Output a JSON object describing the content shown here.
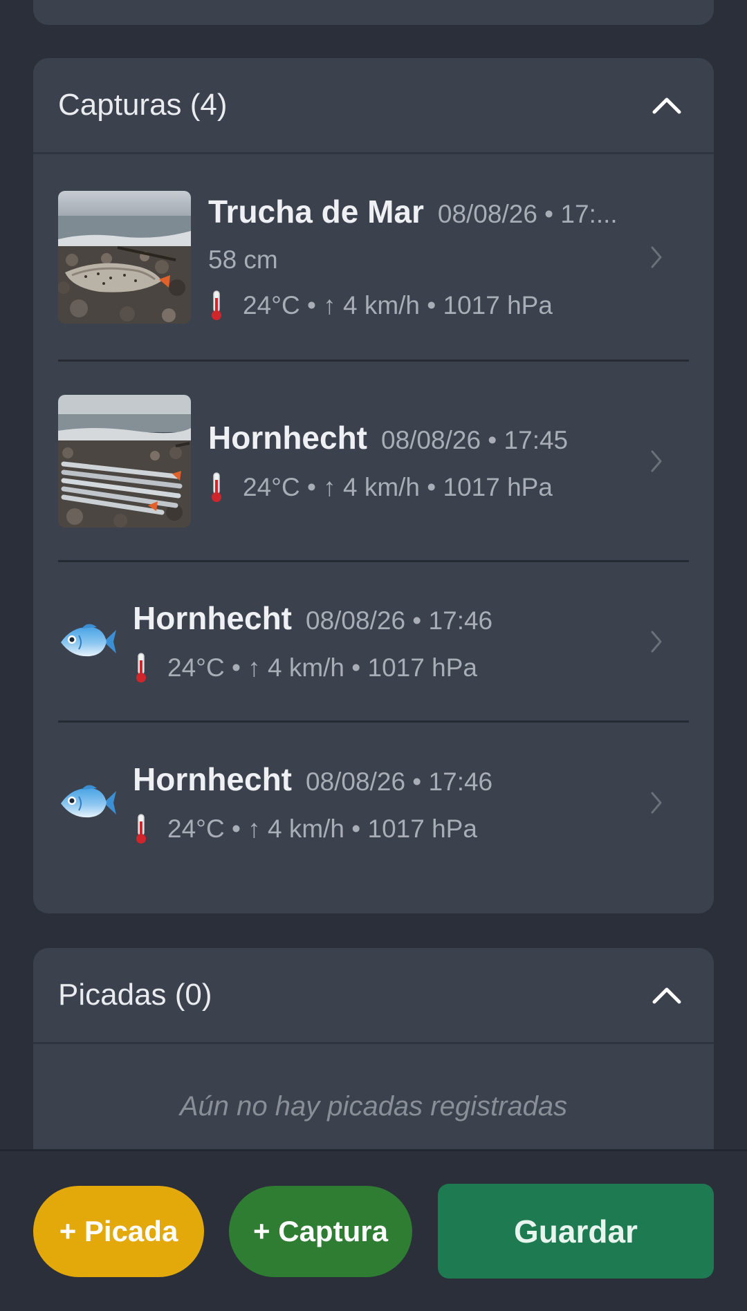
{
  "captures_section": {
    "title": "Capturas (4)",
    "items": [
      {
        "species": "Trucha de Mar",
        "datetime": "08/08/26 • 17:...",
        "size": "58 cm",
        "weather": "24°C • ↑ 4 km/h • 1017 hPa",
        "thumbnail": "photo-sea-trout"
      },
      {
        "species": "Hornhecht",
        "datetime": "08/08/26 • 17:45",
        "weather": "24°C • ↑ 4 km/h • 1017 hPa",
        "thumbnail": "photo-garfish"
      },
      {
        "species": "Hornhecht",
        "datetime": "08/08/26 • 17:46",
        "weather": "24°C • ↑ 4 km/h • 1017 hPa",
        "thumbnail": "fish-icon"
      },
      {
        "species": "Hornhecht",
        "datetime": "08/08/26 • 17:46",
        "weather": "24°C • ↑ 4 km/h • 1017 hPa",
        "thumbnail": "fish-icon"
      }
    ]
  },
  "bites_section": {
    "title": "Picadas (0)",
    "empty_message": "Aún no hay picadas registradas"
  },
  "actions": {
    "add_bite_label": "+ Picada",
    "add_capture_label": "+ Captura",
    "save_label": "Guardar"
  },
  "colors": {
    "background": "#2b2f3a",
    "card": "#3b414d",
    "bite_button": "#e3a80a",
    "capture_button": "#2e7d32",
    "save_button": "#1e7a50"
  }
}
